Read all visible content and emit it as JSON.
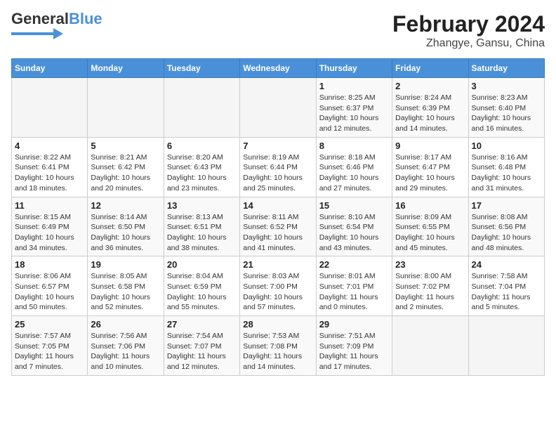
{
  "header": {
    "logo_general": "General",
    "logo_blue": "Blue",
    "title": "February 2024",
    "subtitle": "Zhangye, Gansu, China"
  },
  "weekdays": [
    "Sunday",
    "Monday",
    "Tuesday",
    "Wednesday",
    "Thursday",
    "Friday",
    "Saturday"
  ],
  "weeks": [
    [
      {
        "day": "",
        "info": ""
      },
      {
        "day": "",
        "info": ""
      },
      {
        "day": "",
        "info": ""
      },
      {
        "day": "",
        "info": ""
      },
      {
        "day": "1",
        "info": "Sunrise: 8:25 AM\nSunset: 6:37 PM\nDaylight: 10 hours\nand 12 minutes."
      },
      {
        "day": "2",
        "info": "Sunrise: 8:24 AM\nSunset: 6:39 PM\nDaylight: 10 hours\nand 14 minutes."
      },
      {
        "day": "3",
        "info": "Sunrise: 8:23 AM\nSunset: 6:40 PM\nDaylight: 10 hours\nand 16 minutes."
      }
    ],
    [
      {
        "day": "4",
        "info": "Sunrise: 8:22 AM\nSunset: 6:41 PM\nDaylight: 10 hours\nand 18 minutes."
      },
      {
        "day": "5",
        "info": "Sunrise: 8:21 AM\nSunset: 6:42 PM\nDaylight: 10 hours\nand 20 minutes."
      },
      {
        "day": "6",
        "info": "Sunrise: 8:20 AM\nSunset: 6:43 PM\nDaylight: 10 hours\nand 23 minutes."
      },
      {
        "day": "7",
        "info": "Sunrise: 8:19 AM\nSunset: 6:44 PM\nDaylight: 10 hours\nand 25 minutes."
      },
      {
        "day": "8",
        "info": "Sunrise: 8:18 AM\nSunset: 6:46 PM\nDaylight: 10 hours\nand 27 minutes."
      },
      {
        "day": "9",
        "info": "Sunrise: 8:17 AM\nSunset: 6:47 PM\nDaylight: 10 hours\nand 29 minutes."
      },
      {
        "day": "10",
        "info": "Sunrise: 8:16 AM\nSunset: 6:48 PM\nDaylight: 10 hours\nand 31 minutes."
      }
    ],
    [
      {
        "day": "11",
        "info": "Sunrise: 8:15 AM\nSunset: 6:49 PM\nDaylight: 10 hours\nand 34 minutes."
      },
      {
        "day": "12",
        "info": "Sunrise: 8:14 AM\nSunset: 6:50 PM\nDaylight: 10 hours\nand 36 minutes."
      },
      {
        "day": "13",
        "info": "Sunrise: 8:13 AM\nSunset: 6:51 PM\nDaylight: 10 hours\nand 38 minutes."
      },
      {
        "day": "14",
        "info": "Sunrise: 8:11 AM\nSunset: 6:52 PM\nDaylight: 10 hours\nand 41 minutes."
      },
      {
        "day": "15",
        "info": "Sunrise: 8:10 AM\nSunset: 6:54 PM\nDaylight: 10 hours\nand 43 minutes."
      },
      {
        "day": "16",
        "info": "Sunrise: 8:09 AM\nSunset: 6:55 PM\nDaylight: 10 hours\nand 45 minutes."
      },
      {
        "day": "17",
        "info": "Sunrise: 8:08 AM\nSunset: 6:56 PM\nDaylight: 10 hours\nand 48 minutes."
      }
    ],
    [
      {
        "day": "18",
        "info": "Sunrise: 8:06 AM\nSunset: 6:57 PM\nDaylight: 10 hours\nand 50 minutes."
      },
      {
        "day": "19",
        "info": "Sunrise: 8:05 AM\nSunset: 6:58 PM\nDaylight: 10 hours\nand 52 minutes."
      },
      {
        "day": "20",
        "info": "Sunrise: 8:04 AM\nSunset: 6:59 PM\nDaylight: 10 hours\nand 55 minutes."
      },
      {
        "day": "21",
        "info": "Sunrise: 8:03 AM\nSunset: 7:00 PM\nDaylight: 10 hours\nand 57 minutes."
      },
      {
        "day": "22",
        "info": "Sunrise: 8:01 AM\nSunset: 7:01 PM\nDaylight: 11 hours\nand 0 minutes."
      },
      {
        "day": "23",
        "info": "Sunrise: 8:00 AM\nSunset: 7:02 PM\nDaylight: 11 hours\nand 2 minutes."
      },
      {
        "day": "24",
        "info": "Sunrise: 7:58 AM\nSunset: 7:04 PM\nDaylight: 11 hours\nand 5 minutes."
      }
    ],
    [
      {
        "day": "25",
        "info": "Sunrise: 7:57 AM\nSunset: 7:05 PM\nDaylight: 11 hours\nand 7 minutes."
      },
      {
        "day": "26",
        "info": "Sunrise: 7:56 AM\nSunset: 7:06 PM\nDaylight: 11 hours\nand 10 minutes."
      },
      {
        "day": "27",
        "info": "Sunrise: 7:54 AM\nSunset: 7:07 PM\nDaylight: 11 hours\nand 12 minutes."
      },
      {
        "day": "28",
        "info": "Sunrise: 7:53 AM\nSunset: 7:08 PM\nDaylight: 11 hours\nand 14 minutes."
      },
      {
        "day": "29",
        "info": "Sunrise: 7:51 AM\nSunset: 7:09 PM\nDaylight: 11 hours\nand 17 minutes."
      },
      {
        "day": "",
        "info": ""
      },
      {
        "day": "",
        "info": ""
      }
    ]
  ]
}
